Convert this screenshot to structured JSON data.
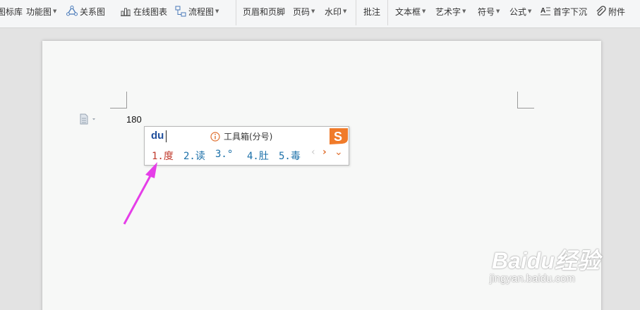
{
  "ribbon": {
    "items": [
      {
        "label": "图标库"
      },
      {
        "label": "功能图",
        "dropdown": true
      },
      {
        "label": "关系图",
        "icon": "relation-chart-icon"
      },
      {
        "label": "在线图表",
        "icon": "online-chart-icon"
      },
      {
        "label": "流程图",
        "icon": "flowchart-icon",
        "dropdown": true
      },
      {
        "label": "页眉和页脚"
      },
      {
        "label": "页码",
        "dropdown": true
      },
      {
        "label": "水印",
        "dropdown": true
      },
      {
        "label": "批注"
      },
      {
        "label": "文本框",
        "dropdown": true
      },
      {
        "label": "艺术字",
        "dropdown": true
      },
      {
        "label": "符号",
        "dropdown": true
      },
      {
        "label": "公式",
        "dropdown": true
      },
      {
        "label": "首字下沉",
        "icon": "drop-cap-icon"
      },
      {
        "label": "附件",
        "icon": "attachment-icon"
      }
    ],
    "dropdown_glyph": "▼"
  },
  "document": {
    "text": "180"
  },
  "ime": {
    "composition": "du",
    "tip": "工具箱(分号)",
    "candidates": [
      "1.度",
      "2.读",
      "3.°",
      "4.肚",
      "5.毒"
    ],
    "prev_glyph": "‹",
    "next_glyph": "›",
    "more_glyph": "⌄",
    "colors": {
      "selected": "#c0392b",
      "normal": "#1a6fa8",
      "logo": "#f07b2a"
    }
  },
  "annotation": {
    "color": "#e53ee8"
  },
  "watermark": {
    "logo": "Baidu经验",
    "url": "jingyan.baidu.com"
  }
}
